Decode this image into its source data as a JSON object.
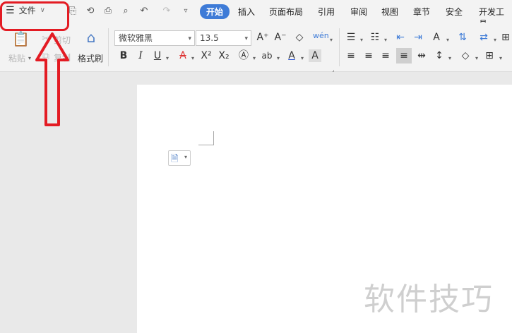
{
  "menu": {
    "file_label": "文件"
  },
  "tabs": [
    {
      "label": "开始",
      "active": true
    },
    {
      "label": "插入"
    },
    {
      "label": "页面布局"
    },
    {
      "label": "引用"
    },
    {
      "label": "审阅"
    },
    {
      "label": "视图"
    },
    {
      "label": "章节"
    },
    {
      "label": "安全"
    },
    {
      "label": "开发工具"
    }
  ],
  "ribbon": {
    "paste_label": "粘贴",
    "cut_label": "剪切",
    "copy_label": "复制",
    "format_painter_label": "格式刷",
    "font_name": "微软雅黑",
    "font_size": "13.5"
  },
  "watermark": "软件技巧",
  "colors": {
    "accent": "#3e7bd7",
    "annotation": "#e31b23"
  }
}
